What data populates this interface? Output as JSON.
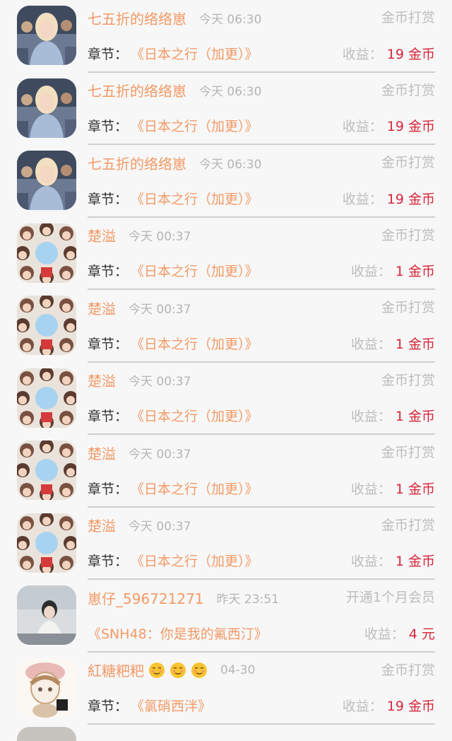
{
  "rows": [
    {
      "name": "七五折的络络崽",
      "time": "今天 06:30",
      "type": "金币打赏",
      "chapter_label": "章节：",
      "chapter": "《日本之行（加更）》",
      "earn_label": "收益：",
      "earn_value": "19 金币",
      "avatar": "avatar-blonde"
    },
    {
      "name": "七五折的络络崽",
      "time": "今天 06:30",
      "type": "金币打赏",
      "chapter_label": "章节：",
      "chapter": "《日本之行（加更）》",
      "earn_label": "收益：",
      "earn_value": "19 金币",
      "avatar": "avatar-blonde"
    },
    {
      "name": "七五折的络络崽",
      "time": "今天 06:30",
      "type": "金币打赏",
      "chapter_label": "章节：",
      "chapter": "《日本之行（加更）》",
      "earn_label": "收益：",
      "earn_value": "19 金币",
      "avatar": "avatar-blonde"
    },
    {
      "name": "楚溢",
      "time": "今天 00:37",
      "type": "金币打赏",
      "chapter_label": "章节：",
      "chapter": "《日本之行（加更）》",
      "earn_label": "收益：",
      "earn_value": "1 金币",
      "avatar": "avatar-group"
    },
    {
      "name": "楚溢",
      "time": "今天 00:37",
      "type": "金币打赏",
      "chapter_label": "章节：",
      "chapter": "《日本之行（加更）》",
      "earn_label": "收益：",
      "earn_value": "1 金币",
      "avatar": "avatar-group"
    },
    {
      "name": "楚溢",
      "time": "今天 00:37",
      "type": "金币打赏",
      "chapter_label": "章节：",
      "chapter": "《日本之行（加更）》",
      "earn_label": "收益：",
      "earn_value": "1 金币",
      "avatar": "avatar-group"
    },
    {
      "name": "楚溢",
      "time": "今天 00:37",
      "type": "金币打赏",
      "chapter_label": "章节：",
      "chapter": "《日本之行（加更）》",
      "earn_label": "收益：",
      "earn_value": "1 金币",
      "avatar": "avatar-group"
    },
    {
      "name": "楚溢",
      "time": "今天 00:37",
      "type": "金币打赏",
      "chapter_label": "章节：",
      "chapter": "《日本之行（加更）》",
      "earn_label": "收益：",
      "earn_value": "1 金币",
      "avatar": "avatar-group"
    },
    {
      "name": "崽仔_596721271",
      "time": "昨天 23:51",
      "type": "开通1个月会员",
      "chapter_label": "",
      "chapter": "《SNH48：你是我的氟西汀》",
      "earn_label": "收益：",
      "earn_value": "4 元",
      "avatar": "avatar-portrait"
    },
    {
      "name": "紅糖粑粑",
      "time": "04-30",
      "type": "金币打赏",
      "chapter_label": "章节：",
      "chapter": "《氯硝西泮》",
      "earn_label": "收益：",
      "earn_value": "19 金币",
      "avatar": "avatar-drawing",
      "emoji_count": 3
    }
  ]
}
